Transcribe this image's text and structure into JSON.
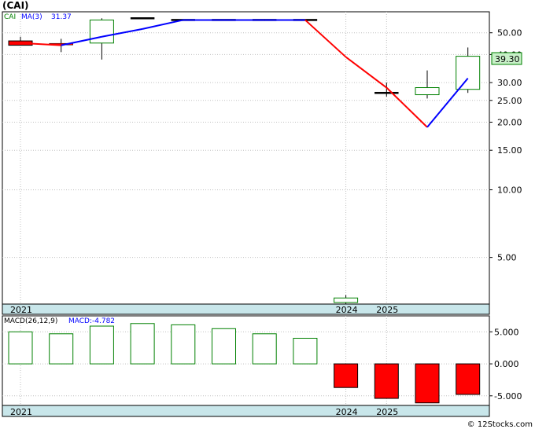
{
  "title": "(CAI)",
  "footer": "© 12Stocks.com",
  "colors": {
    "up": "#008000",
    "down": "#ff0000",
    "ma_up": "#0000ff",
    "ma_down": "#ff0000",
    "axis_band": "#c8e6ea",
    "grid": "#c0c0c0",
    "price_box": "#c8f0c8"
  },
  "chart_data": [
    {
      "type": "candlestick",
      "symbol": "CAI",
      "ma_label": "MA(3)",
      "ma_value": "31.37",
      "last_price": "39.30",
      "scale": "log",
      "ylim": [
        3.1,
        62
      ],
      "y_ticks": [
        "50.00",
        "40.00",
        "30.00",
        "25.00",
        "20.00",
        "15.00",
        "10.00",
        "5.00"
      ],
      "x_labels": [
        {
          "label": "2021",
          "index": 0
        },
        {
          "label": "2024",
          "index": 8
        },
        {
          "label": "2025",
          "index": 9
        }
      ],
      "candles": [
        {
          "open": 46,
          "high": 48,
          "low": 44,
          "close": 44
        },
        {
          "open": 44.5,
          "high": 47,
          "low": 41,
          "close": 44
        },
        {
          "open": 45,
          "high": 58,
          "low": 38,
          "close": 57
        },
        {
          "open": 58,
          "high": 58,
          "low": 58,
          "close": 58
        },
        {
          "open": 57,
          "high": 57,
          "low": 57,
          "close": 57
        },
        {
          "open": 57,
          "high": 57,
          "low": 57,
          "close": 57
        },
        {
          "open": 57,
          "high": 57,
          "low": 57,
          "close": 57
        },
        {
          "open": 57,
          "high": 57,
          "low": 57,
          "close": 57
        },
        {
          "open": 3.15,
          "high": 3.4,
          "low": 3.1,
          "close": 3.3
        },
        {
          "open": 27,
          "high": 30,
          "low": 26,
          "close": 27
        },
        {
          "open": 26.5,
          "high": 34,
          "low": 25.5,
          "close": 28.5
        },
        {
          "open": 28,
          "high": 43,
          "low": 27,
          "close": 39.3
        }
      ],
      "ma": [
        45,
        44,
        48,
        52,
        57,
        57,
        57,
        57,
        39,
        28.5,
        19,
        31.37
      ]
    },
    {
      "type": "bar",
      "label": "MACD(26,12,9)",
      "value_label": "MACD:-4.782",
      "ylim": [
        -6.5,
        7.5
      ],
      "y_ticks": [
        "5.000",
        "0.000",
        "-5.000"
      ],
      "values": [
        5.0,
        4.7,
        5.9,
        6.3,
        6.1,
        5.5,
        4.7,
        4.0,
        -3.7,
        -5.4,
        -6.1,
        -4.782
      ]
    }
  ]
}
